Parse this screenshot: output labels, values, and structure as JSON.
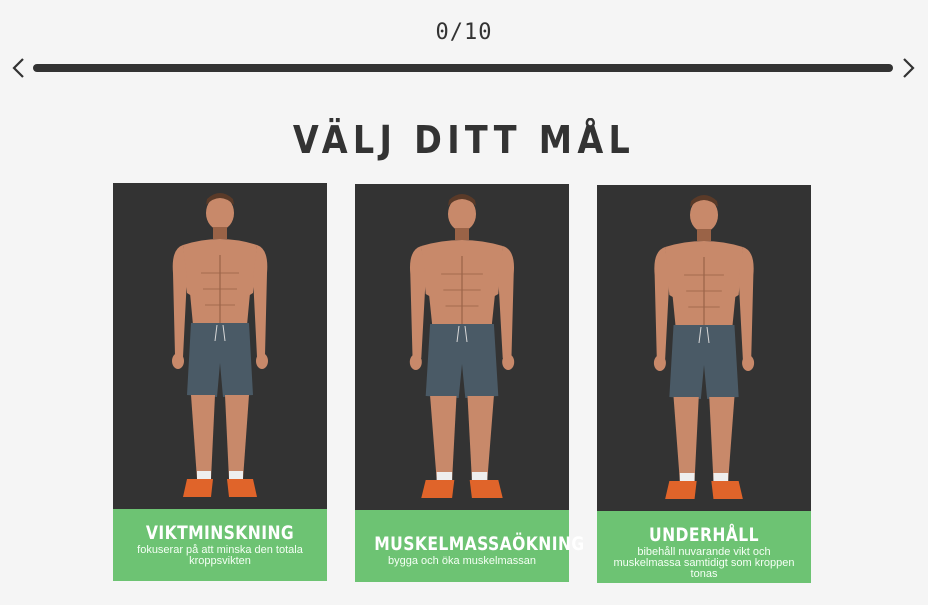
{
  "progress": {
    "counter_text": "0/10",
    "current": 0,
    "total": 10,
    "fill_fraction": 0.0
  },
  "navigation": {
    "prev_icon": "chevron-left-icon",
    "next_icon": "chevron-right-icon"
  },
  "page": {
    "title": "VÄLJ DITT MÅL"
  },
  "goals": [
    {
      "title": "VIKTMINSKNING",
      "description": "fokuserar på att minska den totala kroppsvikten",
      "physique": "lean"
    },
    {
      "title": "MUSKELMASSAÖKNING",
      "description": "bygga och öka muskelmassan",
      "physique": "muscular"
    },
    {
      "title": "UNDERHÅLL",
      "description": "bibehåll nuvarande vikt och muskelmassa samtidigt som kroppen tonas",
      "physique": "toned"
    }
  ],
  "colors": {
    "background": "#f5f5f5",
    "card_image_bg": "#333333",
    "card_label_bg": "#6dc373",
    "text": "#333333",
    "label_text": "#ffffff"
  }
}
